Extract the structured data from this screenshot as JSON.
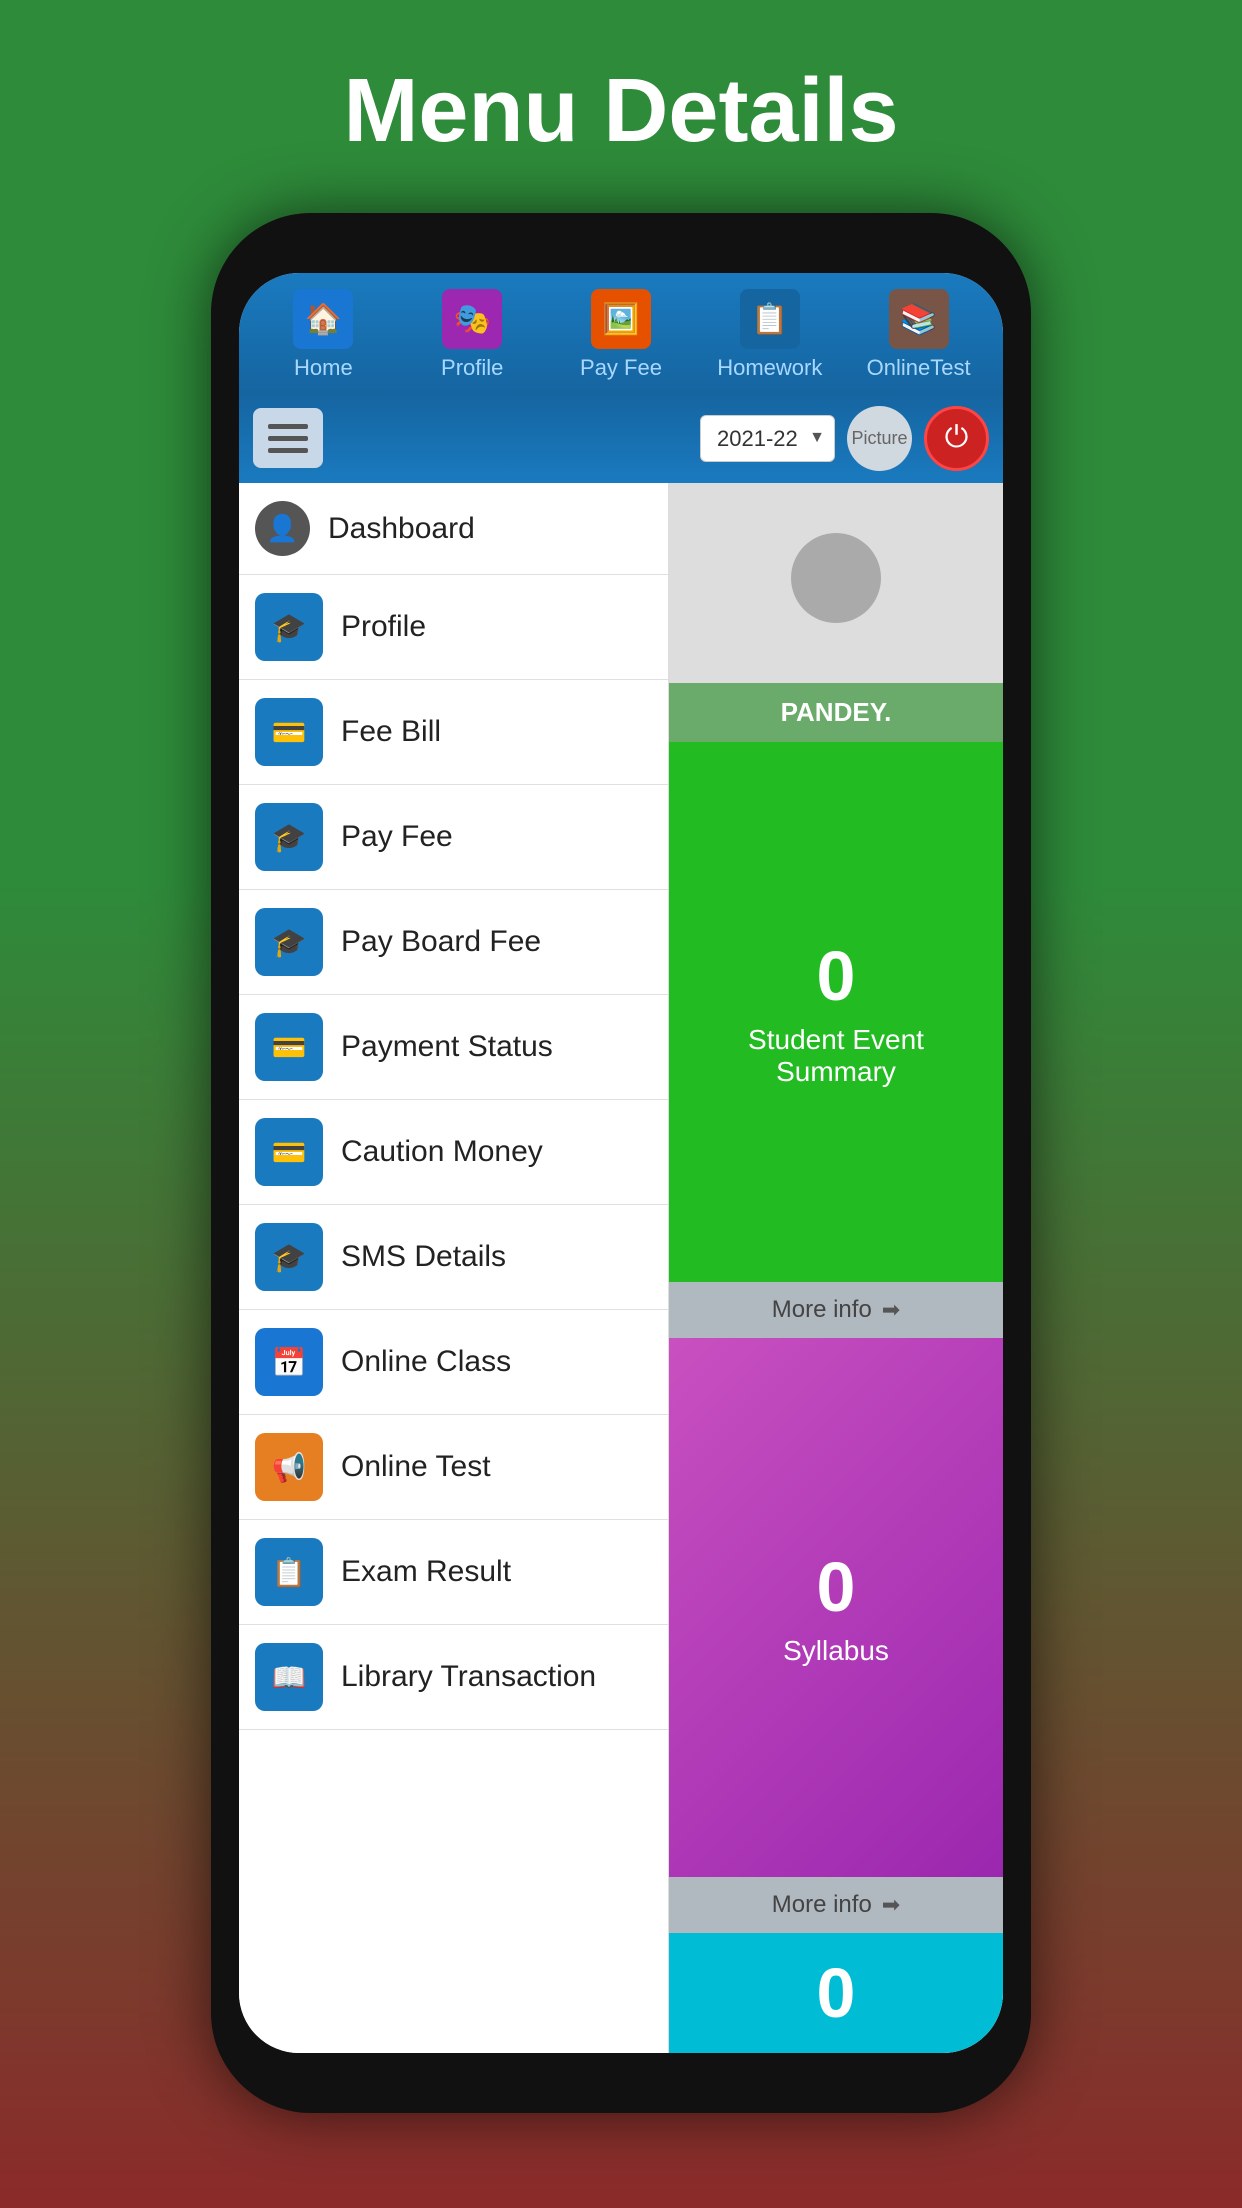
{
  "page": {
    "title": "Menu Details",
    "background_top": "#2e8b3a",
    "background_bottom": "#8b2a2a"
  },
  "top_nav": {
    "items": [
      {
        "label": "Home",
        "icon": "🏠"
      },
      {
        "label": "Profile",
        "icon": "👤"
      },
      {
        "label": "Pay Fee",
        "icon": "💳"
      },
      {
        "label": "Homework",
        "icon": "📋"
      },
      {
        "label": "OnlineTest",
        "icon": "📚"
      }
    ]
  },
  "header": {
    "year": "2021-22",
    "picture_label": "Picture",
    "power_icon": "⏻"
  },
  "sidebar": {
    "items": [
      {
        "label": "Dashboard",
        "icon": "👤",
        "type": "dashboard"
      },
      {
        "label": "Profile",
        "icon": "🎓",
        "type": "blue"
      },
      {
        "label": "Fee Bill",
        "icon": "💳",
        "type": "blue"
      },
      {
        "label": "Pay Fee",
        "icon": "🎓",
        "type": "blue"
      },
      {
        "label": "Pay Board Fee",
        "icon": "🎓",
        "type": "blue"
      },
      {
        "label": "Payment Status",
        "icon": "💳",
        "type": "blue"
      },
      {
        "label": "Caution Money",
        "icon": "💳",
        "type": "blue"
      },
      {
        "label": "SMS Details",
        "icon": "🎓",
        "type": "blue"
      },
      {
        "label": "Online Class",
        "icon": "📅",
        "type": "calendar"
      },
      {
        "label": "Online Test",
        "icon": "📢",
        "type": "orange"
      },
      {
        "label": "Exam Result",
        "icon": "📋",
        "type": "blue"
      },
      {
        "label": "Library Transaction",
        "icon": "📖",
        "type": "blue"
      }
    ]
  },
  "right_panel": {
    "name_banner": "PANDEY.",
    "cards": [
      {
        "type": "green",
        "number": "0",
        "label": "Student Event Summary",
        "more_info": "More info"
      },
      {
        "type": "purple",
        "number": "0",
        "label": "Syllabus",
        "more_info": "More info"
      },
      {
        "type": "teal",
        "number": "0"
      }
    ]
  }
}
